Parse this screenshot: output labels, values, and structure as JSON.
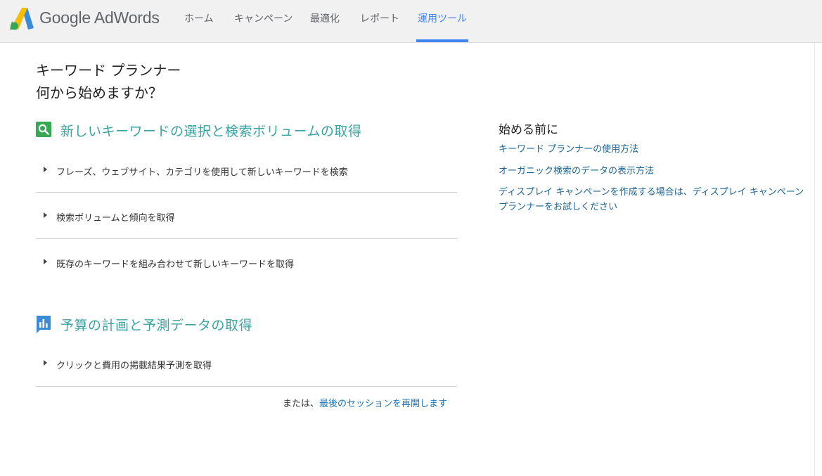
{
  "header": {
    "brand": "Google AdWords",
    "nav": [
      {
        "label": "ホーム"
      },
      {
        "label": "キャンペーン"
      },
      {
        "label": "最適化"
      },
      {
        "label": "レポート"
      },
      {
        "label": "運用ツール",
        "active": true
      }
    ]
  },
  "main": {
    "title": "キーワード プランナー",
    "subtitle": "何から始めますか？",
    "sections": [
      {
        "icon": "search-icon",
        "heading": "新しいキーワードの選択と検索ボリュームの取得",
        "options": [
          "フレーズ、ウェブサイト、カテゴリを使用して新しいキーワードを検索",
          "検索ボリュームと傾向を取得",
          "既存のキーワードを組み合わせて新しいキーワードを取得"
        ]
      },
      {
        "icon": "bar-chart-icon",
        "heading": "予算の計画と予測データの取得",
        "options": [
          "クリックと費用の掲載結果予測を取得"
        ]
      }
    ],
    "resume": {
      "prefix": "または、",
      "link": "最後のセッションを再開します"
    }
  },
  "sidebar": {
    "title": "始める前に",
    "links": [
      "キーワード プランナーの使用方法",
      "オーガニック検索のデータの表示方法",
      "ディスプレイ キャンペーンを作成する場合は、ディスプレイ キャンペーン プランナーをお試しください"
    ]
  },
  "colors": {
    "accent_blue": "#4285f4",
    "section_teal": "#3aa3a3",
    "link_blue": "#1a6496",
    "header_bg": "#f1f1f1"
  }
}
